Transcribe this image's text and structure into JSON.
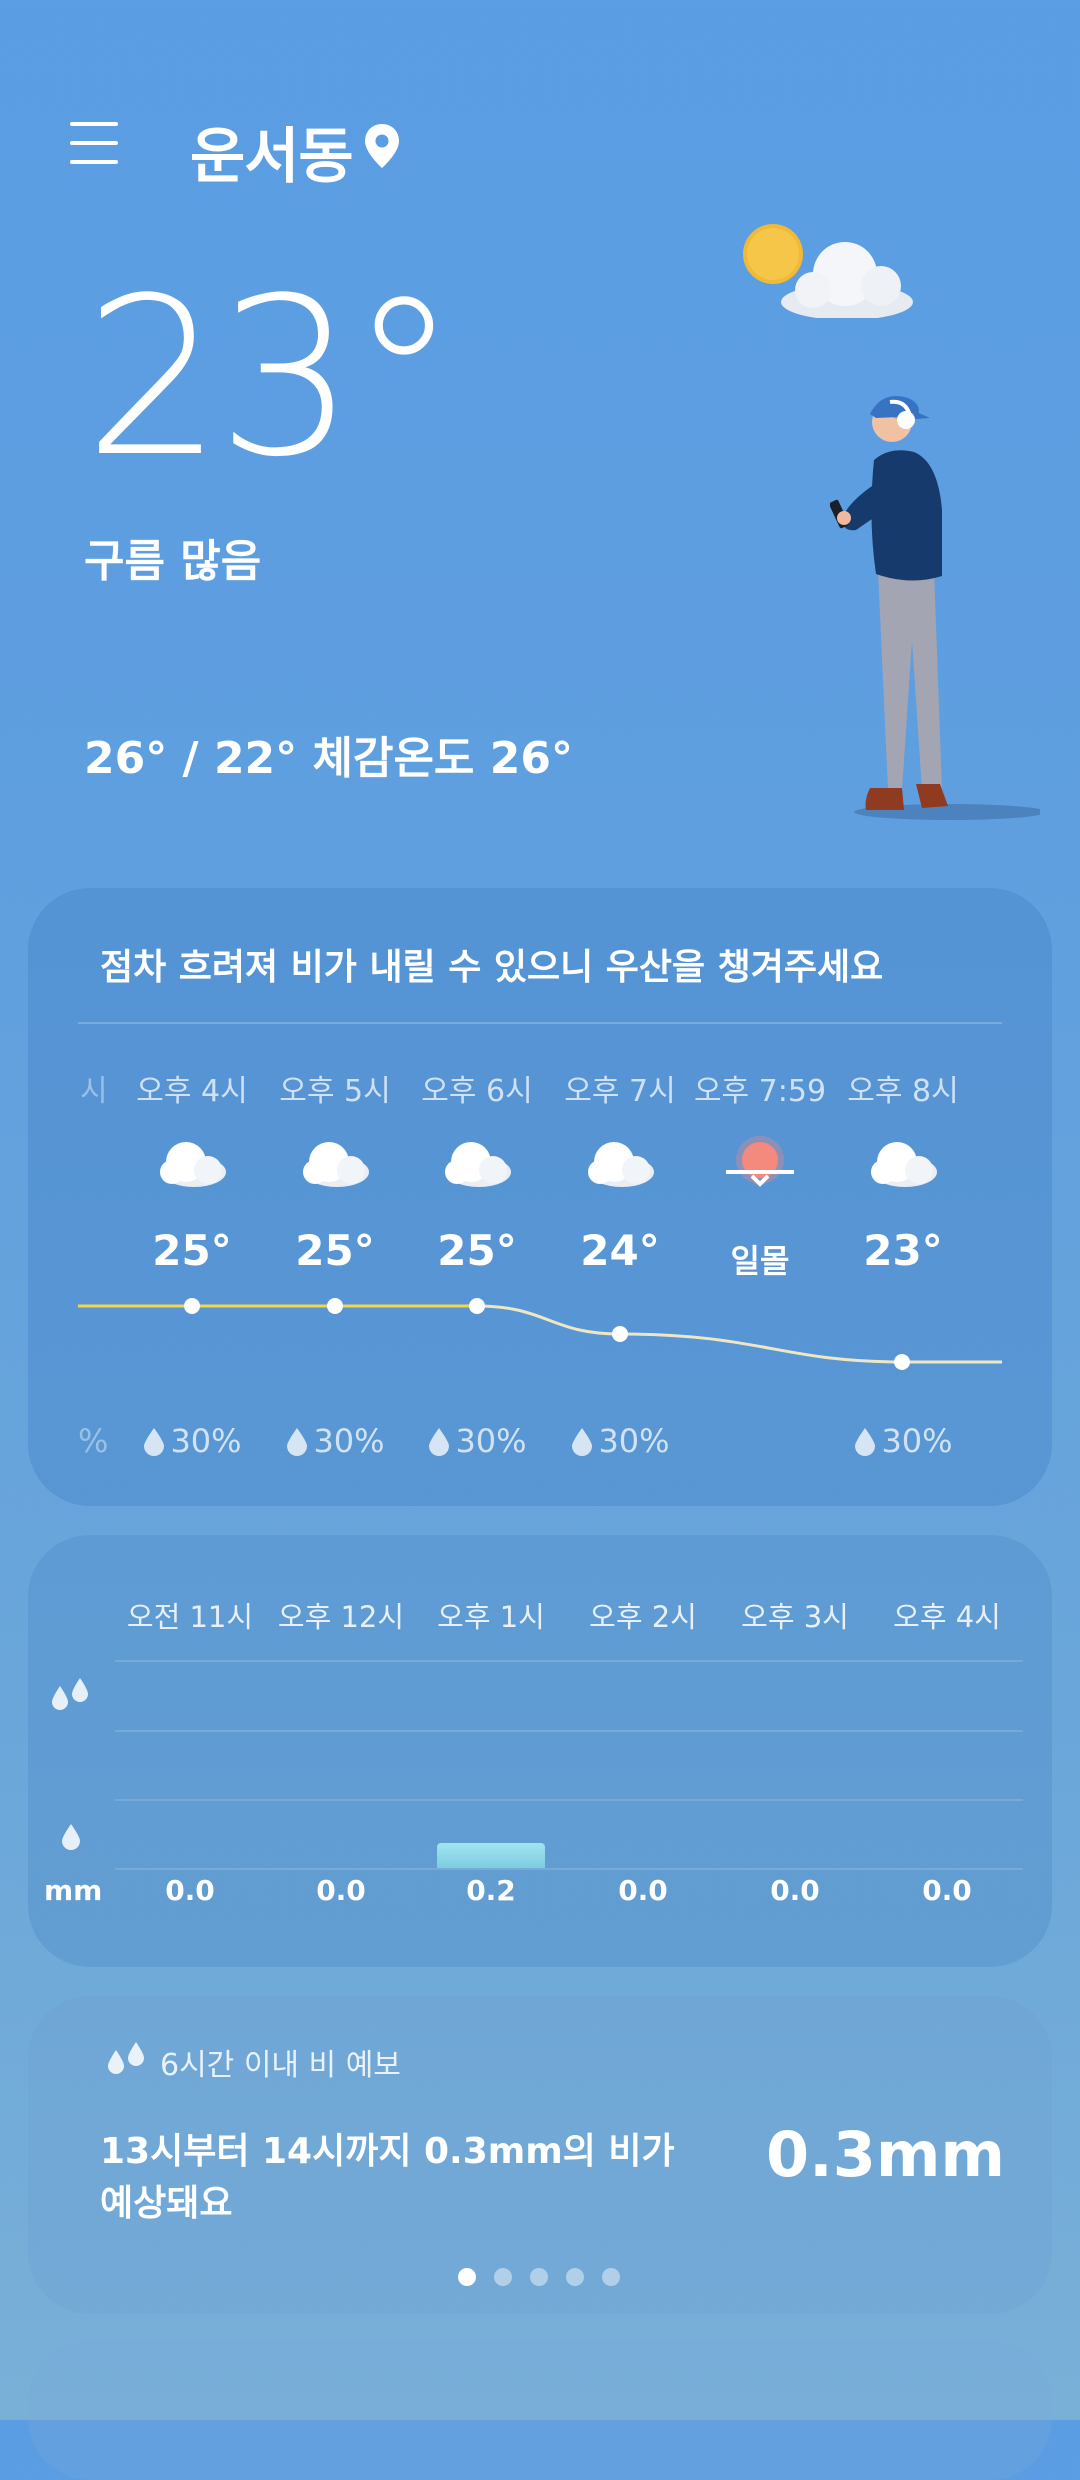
{
  "header": {
    "location": "운서동",
    "menu_icon": "menu-icon",
    "pin_icon": "location-pin-icon"
  },
  "current": {
    "temperature": "23°",
    "condition": "구름 많음",
    "minmax_feels": "26° / 22° 체감온도 26°",
    "illustration": "partly-cloudy-sun-icon"
  },
  "hourly": {
    "message": "점차 흐려져 비가 내릴 수 있으니 우산을 챙겨주세요",
    "left_edge_label": "시",
    "left_edge_rain": "%",
    "items": [
      {
        "time": "오후 4시",
        "icon": "cloud-icon",
        "temp": "25°",
        "temp_value": 25,
        "rain": "30%"
      },
      {
        "time": "오후 5시",
        "icon": "cloud-icon",
        "temp": "25°",
        "temp_value": 25,
        "rain": "30%"
      },
      {
        "time": "오후 6시",
        "icon": "cloud-icon",
        "temp": "25°",
        "temp_value": 25,
        "rain": "30%"
      },
      {
        "time": "오후 7시",
        "icon": "cloud-icon",
        "temp": "24°",
        "temp_value": 24,
        "rain": "30%"
      },
      {
        "time": "오후 7:59",
        "icon": "sunset-icon",
        "temp": "일몰",
        "temp_value": null,
        "rain": ""
      },
      {
        "time": "오후 8시",
        "icon": "cloud-icon",
        "temp": "23°",
        "temp_value": 23,
        "rain": "30%"
      }
    ]
  },
  "precipitation": {
    "unit": "mm",
    "items": [
      {
        "time": "오전 11시",
        "amount": "0.0",
        "value": 0.0
      },
      {
        "time": "오후 12시",
        "amount": "0.0",
        "value": 0.0
      },
      {
        "time": "오후 1시",
        "amount": "0.2",
        "value": 0.2
      },
      {
        "time": "오후 2시",
        "amount": "0.0",
        "value": 0.0
      },
      {
        "time": "오후 3시",
        "amount": "0.0",
        "value": 0.0
      },
      {
        "time": "오후 4시",
        "amount": "0.0",
        "value": 0.0
      }
    ]
  },
  "forecast": {
    "title": "6시간 이내 비 예보",
    "text": "13시부터 14시까지 0.3mm의 비가 예상돼요",
    "amount": "0.3mm",
    "page_count": 5,
    "active_page": 1
  },
  "colors": {
    "temp_line_past": "#f3d54a",
    "temp_line_future": "#efe6c4",
    "sunset": "#f48a7e",
    "rain_bar": "#9fe4ee"
  }
}
